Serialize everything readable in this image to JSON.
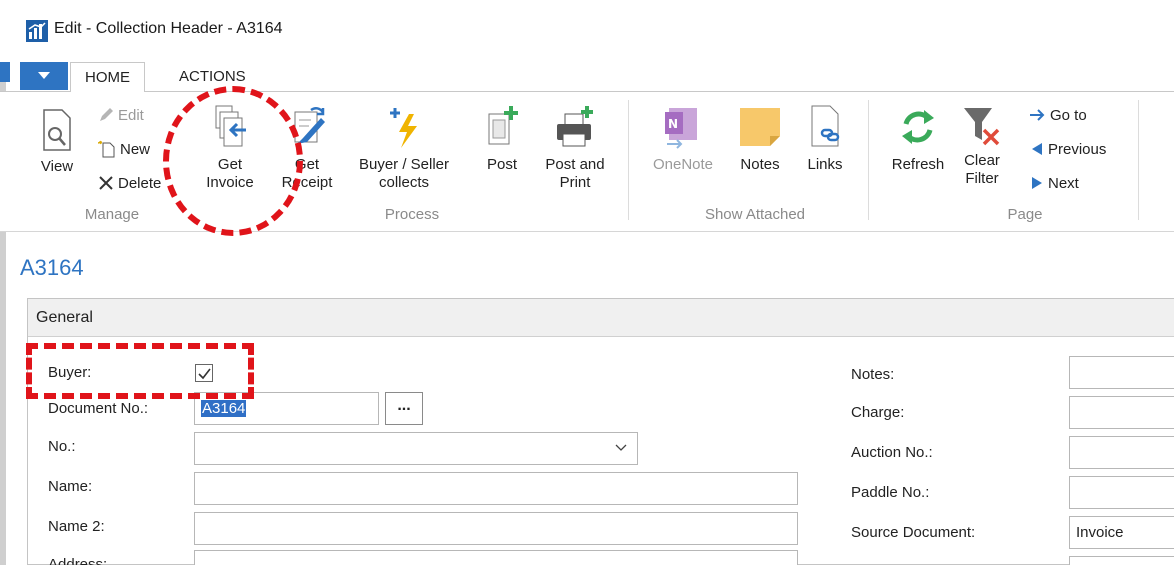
{
  "window": {
    "title": "Edit - Collection Header - A3164"
  },
  "ribbon": {
    "tabs": [
      {
        "label": "HOME"
      },
      {
        "label": "ACTIONS"
      }
    ],
    "manage": {
      "group_label": "Manage",
      "view": "View",
      "edit": "Edit",
      "new": "New",
      "delete": "Delete"
    },
    "process": {
      "group_label": "Process",
      "get_invoice": [
        "Get",
        "Invoice"
      ],
      "get_receipt": [
        "Get",
        "Receipt"
      ],
      "buyer_seller": [
        "Buyer / Seller",
        "collects"
      ],
      "post": "Post",
      "post_print": [
        "Post and",
        "Print"
      ]
    },
    "show_attached": {
      "group_label": "Show Attached",
      "onenote": "OneNote",
      "notes": "Notes",
      "links": "Links"
    },
    "page": {
      "group_label": "Page",
      "refresh": "Refresh",
      "clear_filter": [
        "Clear",
        "Filter"
      ],
      "go_to": "Go to",
      "previous": "Previous",
      "next": "Next"
    }
  },
  "record": {
    "title": "A3164"
  },
  "general": {
    "header": "General",
    "left_fields": {
      "buyer_label": "Buyer:",
      "document_no_label": "Document No.:",
      "document_no_value": "A3164",
      "no_label": "No.:",
      "name_label": "Name:",
      "name2_label": "Name 2:",
      "address_label": "Address:"
    },
    "right_fields": {
      "notes_label": "Notes:",
      "charge_label": "Charge:",
      "auction_no_label": "Auction No.:",
      "paddle_no_label": "Paddle No.:",
      "source_document_label": "Source Document:",
      "source_document_value": "Invoice"
    }
  },
  "colors": {
    "accent": "#2e74c2",
    "annotation": "#e0141a"
  }
}
